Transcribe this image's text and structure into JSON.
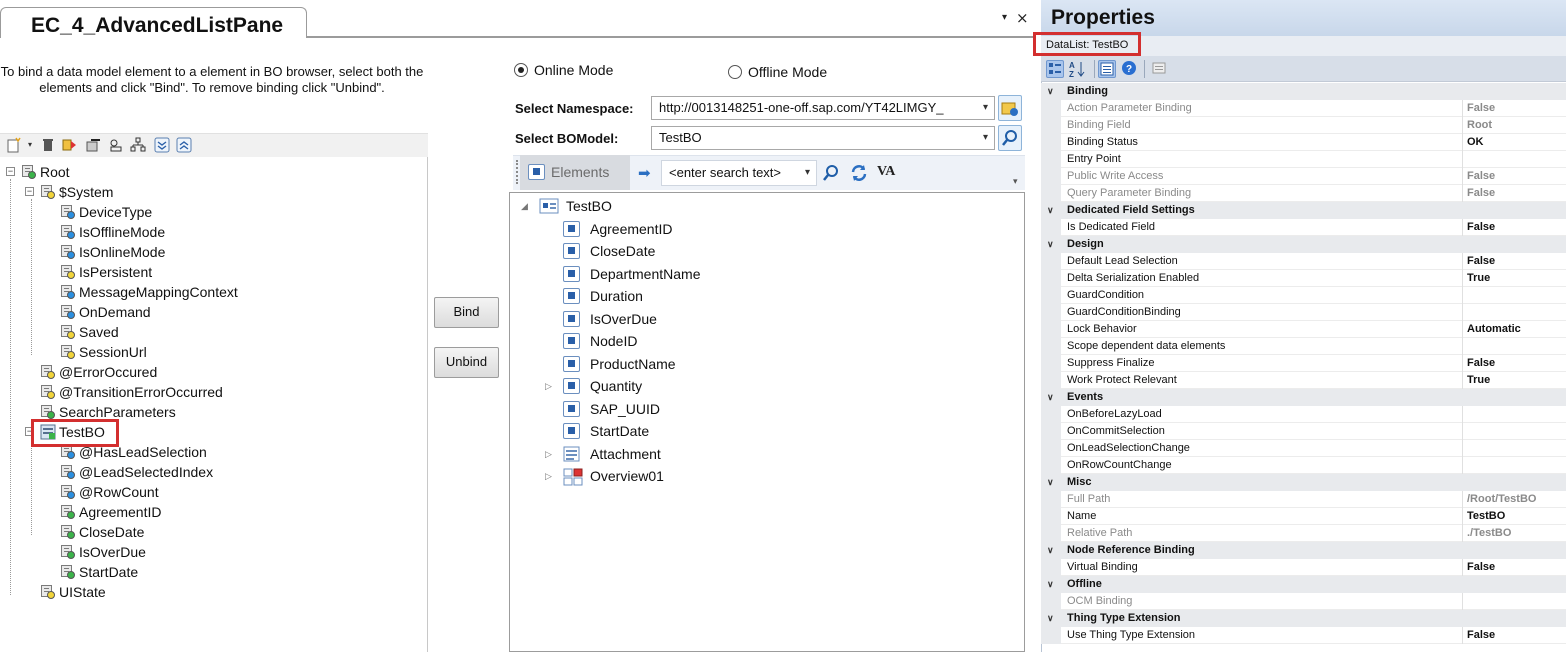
{
  "editor": {
    "tab_title": "EC_4_AdvancedListPane",
    "tab_dropdown_icon": "▾",
    "tab_close_icon": "×",
    "instructions": "To bind a data model element to a element in BO browser, select both the elements and click \"Bind\". To remove binding click \"Unbind\"."
  },
  "data_model_tree": [
    {
      "label": "Root"
    },
    {
      "label": "$System"
    },
    {
      "label": "DeviceType"
    },
    {
      "label": "IsOfflineMode"
    },
    {
      "label": "IsOnlineMode"
    },
    {
      "label": "IsPersistent"
    },
    {
      "label": "MessageMappingContext"
    },
    {
      "label": "OnDemand"
    },
    {
      "label": "Saved"
    },
    {
      "label": "SessionUrl"
    },
    {
      "label": "@ErrorOccured"
    },
    {
      "label": "@TransitionErrorOccurred"
    },
    {
      "label": "SearchParameters"
    },
    {
      "label": "TestBO"
    },
    {
      "label": "@HasLeadSelection"
    },
    {
      "label": "@LeadSelectedIndex"
    },
    {
      "label": "@RowCount"
    },
    {
      "label": "AgreementID"
    },
    {
      "label": "CloseDate"
    },
    {
      "label": "IsOverDue"
    },
    {
      "label": "StartDate"
    },
    {
      "label": "UIState"
    }
  ],
  "actions": {
    "bind_label": "Bind",
    "unbind_label": "Unbind"
  },
  "bo_browser": {
    "online_mode_label": "Online Mode",
    "offline_mode_label": "Offline Mode",
    "online_selected": true,
    "namespace_label": "Select Namespace:",
    "namespace_value": "http://0013148251-one-off.sap.com/YT42LIMGY_",
    "bomodel_label": "Select BOModel:",
    "bomodel_value": "TestBO",
    "elements_label": "Elements",
    "search_placeholder": "<enter search text>",
    "va_label": "VA",
    "tree": [
      {
        "label": "TestBO"
      },
      {
        "label": "AgreementID"
      },
      {
        "label": "CloseDate"
      },
      {
        "label": "DepartmentName"
      },
      {
        "label": "Duration"
      },
      {
        "label": "IsOverDue"
      },
      {
        "label": "NodeID"
      },
      {
        "label": "ProductName"
      },
      {
        "label": "Quantity"
      },
      {
        "label": "SAP_UUID"
      },
      {
        "label": "StartDate"
      },
      {
        "label": "Attachment"
      },
      {
        "label": "Overview01"
      }
    ]
  },
  "properties": {
    "title": "Properties",
    "selected_object": "DataList: TestBO",
    "rows": [
      {
        "type": "cat",
        "name": "Binding"
      },
      {
        "type": "item",
        "name": "Action Parameter Binding",
        "value": "False",
        "ro": true
      },
      {
        "type": "item",
        "name": "Binding Field",
        "value": "Root",
        "ro": true
      },
      {
        "type": "item",
        "name": "Binding Status",
        "value": "OK",
        "ro": false
      },
      {
        "type": "item",
        "name": "Entry Point",
        "value": "",
        "ro": false
      },
      {
        "type": "item",
        "name": "Public Write Access",
        "value": "False",
        "ro": true
      },
      {
        "type": "item",
        "name": "Query Parameter Binding",
        "value": "False",
        "ro": true
      },
      {
        "type": "cat",
        "name": "Dedicated Field Settings"
      },
      {
        "type": "item",
        "name": "Is Dedicated Field",
        "value": "False",
        "ro": false
      },
      {
        "type": "cat",
        "name": "Design"
      },
      {
        "type": "item",
        "name": "Default Lead Selection",
        "value": "False",
        "ro": false
      },
      {
        "type": "item",
        "name": "Delta Serialization Enabled",
        "value": "True",
        "ro": false
      },
      {
        "type": "item",
        "name": "GuardCondition",
        "value": "",
        "ro": false
      },
      {
        "type": "item",
        "name": "GuardConditionBinding",
        "value": "",
        "ro": false
      },
      {
        "type": "item",
        "name": "Lock Behavior",
        "value": "Automatic",
        "ro": false
      },
      {
        "type": "item",
        "name": "Scope dependent data elements",
        "value": "",
        "ro": false
      },
      {
        "type": "item",
        "name": "Suppress Finalize",
        "value": "False",
        "ro": false
      },
      {
        "type": "item",
        "name": "Work Protect Relevant",
        "value": "True",
        "ro": false
      },
      {
        "type": "cat",
        "name": "Events"
      },
      {
        "type": "item",
        "name": "OnBeforeLazyLoad",
        "value": "",
        "ro": false
      },
      {
        "type": "item",
        "name": "OnCommitSelection",
        "value": "",
        "ro": false
      },
      {
        "type": "item",
        "name": "OnLeadSelectionChange",
        "value": "",
        "ro": false
      },
      {
        "type": "item",
        "name": "OnRowCountChange",
        "value": "",
        "ro": false
      },
      {
        "type": "cat",
        "name": "Misc"
      },
      {
        "type": "item",
        "name": "Full Path",
        "value": "/Root/TestBO",
        "ro": true
      },
      {
        "type": "item",
        "name": "Name",
        "value": "TestBO",
        "ro": false
      },
      {
        "type": "item",
        "name": "Relative Path",
        "value": "./TestBO",
        "ro": true
      },
      {
        "type": "cat",
        "name": "Node Reference Binding"
      },
      {
        "type": "item",
        "name": "Virtual Binding",
        "value": "False",
        "ro": false
      },
      {
        "type": "cat",
        "name": "Offline"
      },
      {
        "type": "item",
        "name": "OCM Binding",
        "value": "",
        "ro": true
      },
      {
        "type": "cat",
        "name": "Thing Type Extension"
      },
      {
        "type": "item",
        "name": "Use Thing Type Extension",
        "value": "False",
        "ro": false
      }
    ]
  },
  "colors": {
    "highlight_red": "#d32f2f",
    "properties_header": "#dbe6f4",
    "category_bg": "#e8eaed"
  }
}
